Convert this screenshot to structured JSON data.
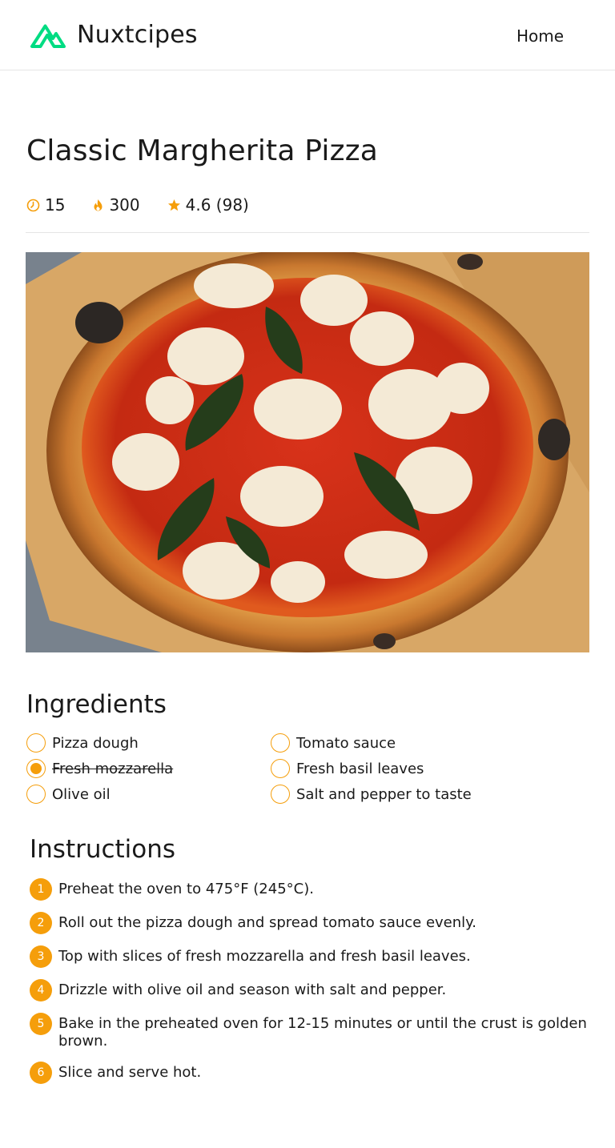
{
  "header": {
    "brand": "Nuxtcipes",
    "nav_home": "Home",
    "logo_icon": "nuxt-logo-icon",
    "accent": "#00dc82"
  },
  "recipe": {
    "title": "Classic Margherita Pizza",
    "stats": {
      "time": "15",
      "time_icon": "clock-icon",
      "calories": "300",
      "calories_icon": "flame-icon",
      "rating": "4.6 (98)",
      "rating_icon": "star-icon"
    },
    "image_alt": "Classic Margherita Pizza"
  },
  "ingredients": {
    "heading": "Ingredients",
    "items": [
      {
        "label": "Pizza dough",
        "checked": false
      },
      {
        "label": "Tomato sauce",
        "checked": false
      },
      {
        "label": "Fresh mozzarella",
        "checked": true
      },
      {
        "label": "Fresh basil leaves",
        "checked": false
      },
      {
        "label": "Olive oil",
        "checked": false
      },
      {
        "label": "Salt and pepper to taste",
        "checked": false
      }
    ]
  },
  "instructions": {
    "heading": "Instructions",
    "steps": [
      {
        "number": "1",
        "text": "Preheat the oven to 475°F (245°C)."
      },
      {
        "number": "2",
        "text": "Roll out the pizza dough and spread tomato sauce evenly."
      },
      {
        "number": "3",
        "text": "Top with slices of fresh mozzarella and fresh basil leaves."
      },
      {
        "number": "4",
        "text": "Drizzle with olive oil and season with salt and pepper."
      },
      {
        "number": "5",
        "text": "Bake in the preheated oven for 12-15 minutes or until the crust is golden brown."
      },
      {
        "number": "6",
        "text": "Slice and serve hot."
      }
    ]
  },
  "colors": {
    "accent": "#f59e0b",
    "text": "#1a1a1a",
    "border": "#e5e5e5"
  }
}
